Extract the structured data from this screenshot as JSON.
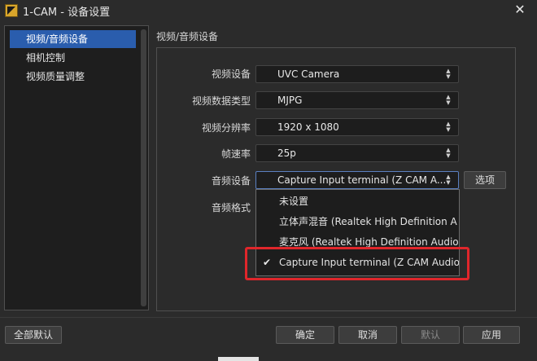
{
  "window": {
    "title": "1-CAM - 设备设置"
  },
  "sidebar": {
    "items": [
      {
        "label": "视频/音频设备",
        "active": true
      },
      {
        "label": "相机控制",
        "active": false
      },
      {
        "label": "视频质量调整",
        "active": false
      }
    ]
  },
  "section": {
    "title": "视频/音频设备"
  },
  "form": {
    "video_device": {
      "label": "视频设备",
      "value": "UVC Camera"
    },
    "video_data_type": {
      "label": "视频数据类型",
      "value": "MJPG"
    },
    "video_resolution": {
      "label": "视频分辨率",
      "value": "1920 x 1080"
    },
    "frame_rate": {
      "label": "帧速率",
      "value": "25p"
    },
    "audio_device": {
      "label": "音频设备",
      "value": "Capture Input terminal (Z CAM A...",
      "options_button": "选项"
    },
    "audio_format": {
      "label": "音频格式"
    }
  },
  "audio_dropdown": {
    "options": [
      {
        "label": "未设置",
        "selected": false
      },
      {
        "label": "立体声混音 (Realtek High Definition A",
        "selected": false
      },
      {
        "label": "麦克风 (Realtek High Definition Audio)",
        "selected": false
      },
      {
        "label": "Capture Input terminal (Z CAM Audio)",
        "selected": true
      }
    ],
    "check_mark": "✔"
  },
  "footer": {
    "reset_all": "全部默认",
    "ok": "确定",
    "cancel": "取消",
    "default": "默认",
    "apply": "应用"
  },
  "colors": {
    "selection": "#2a5dad",
    "highlight_box": "#e0262b",
    "background": "#2b2b2b"
  },
  "icons": {
    "close": "close-icon",
    "spin": "up-down-arrows-icon",
    "check": "check-icon"
  }
}
